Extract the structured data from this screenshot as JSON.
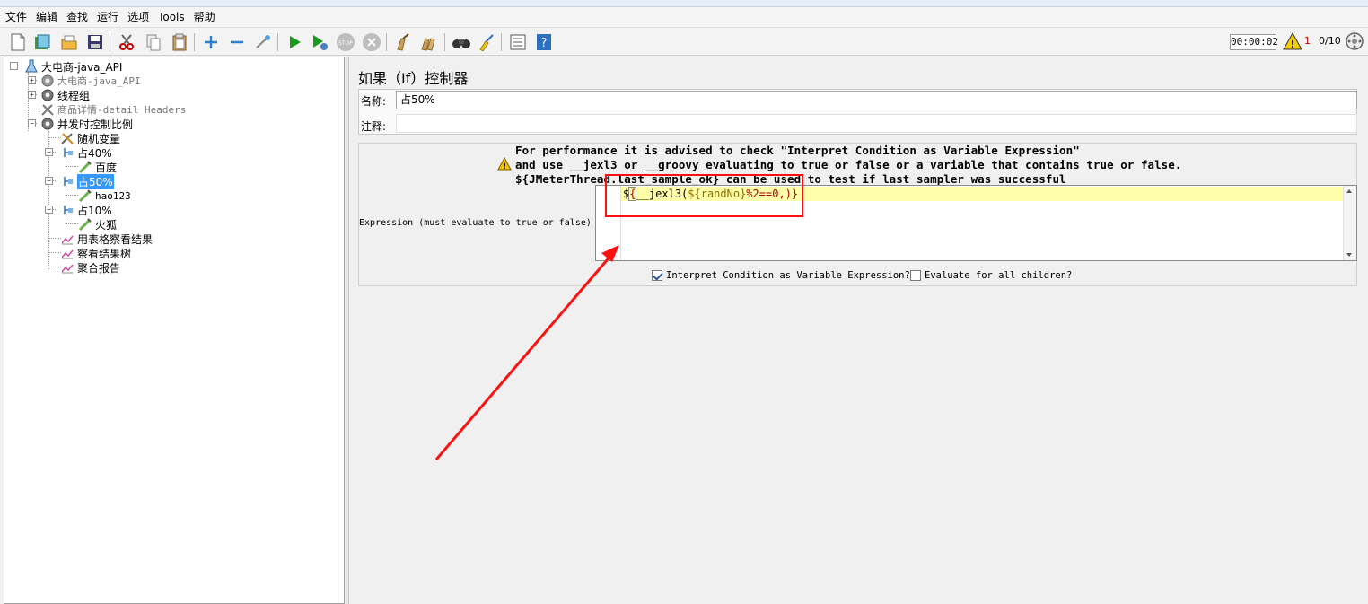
{
  "menubar": {
    "items": [
      "文件",
      "编辑",
      "查找",
      "运行",
      "选项",
      "Tools",
      "帮助"
    ]
  },
  "toolbar": {
    "icons": [
      "new-icon",
      "templates-icon",
      "open-icon",
      "save-icon",
      "cut-icon",
      "copy-icon",
      "paste-icon",
      "expand-icon",
      "collapse-icon",
      "toggle-icon",
      "start-icon",
      "start-no-pause-icon",
      "stop-icon",
      "shutdown-icon",
      "clear-icon",
      "clear-all-icon",
      "search-icon",
      "reset-search-icon",
      "function-helper-icon",
      "help-icon"
    ],
    "timer": "00:00:02",
    "warning_count": "1",
    "thread_count": "0/10"
  },
  "tree": {
    "nodes": [
      {
        "label": "大电商-java_API",
        "icon": "test-plan-icon"
      },
      {
        "label": "大电商-java_API",
        "icon": "gear-icon",
        "disabled": true
      },
      {
        "label": "线程组",
        "icon": "gear-icon"
      },
      {
        "label": "商品详情-detail Headers",
        "icon": "wrench-icon",
        "disabled": true
      },
      {
        "label": "并发时控制比例",
        "icon": "gear-icon"
      },
      {
        "label": "随机变量",
        "icon": "wrench-icon"
      },
      {
        "label": "占40%",
        "icon": "if-controller-icon"
      },
      {
        "label": "百度",
        "icon": "pipette-icon"
      },
      {
        "label": "占50%",
        "icon": "if-controller-icon",
        "selected": true
      },
      {
        "label": "hao123",
        "icon": "pipette-icon"
      },
      {
        "label": "占10%",
        "icon": "if-controller-icon"
      },
      {
        "label": "火狐",
        "icon": "pipette-icon"
      },
      {
        "label": "用表格察看结果",
        "icon": "graph-icon"
      },
      {
        "label": "察看结果树",
        "icon": "graph-icon"
      },
      {
        "label": "聚合报告",
        "icon": "graph-icon"
      }
    ]
  },
  "panel": {
    "title": "如果（If）控制器",
    "name_label": "名称:",
    "name_value": "占50%",
    "comment_label": "注释:",
    "comment_value": "",
    "advice_line1": "For performance it is advised to check \"Interpret Condition as Variable Expression\"",
    "advice_line2": "and use __jexl3 or __groovy evaluating to true or false or a variable that contains true or false.",
    "advice_line3": "${JMeterThread.last_sample_ok} can be used to test if last sampler was successful",
    "expression_label": "Expression (must evaluate to true or false)",
    "expression": {
      "dollar": "$",
      "open": "{",
      "func": "__jexl3(",
      "var": "${randNo}",
      "rest": "%2==0,)}"
    },
    "checkbox_interpret_label": "Interpret Condition as Variable Expression?",
    "checkbox_interpret_checked": true,
    "checkbox_children_label": "Evaluate for all children?",
    "checkbox_children_checked": false
  },
  "colors": {
    "annotation": "#ff1010",
    "selection": "#3399ff",
    "current_line": "#ffffaa"
  }
}
